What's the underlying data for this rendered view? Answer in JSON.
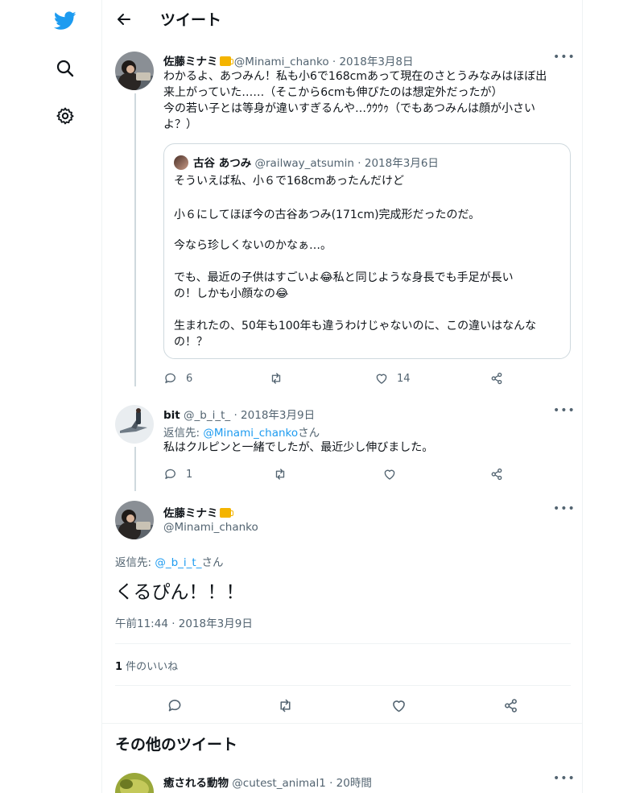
{
  "app": {
    "brand_color": "#1d9bf0",
    "text_color": "#0f1419",
    "muted_color": "#536471"
  },
  "sidebar": {
    "items": [
      {
        "icon": "twitter-logo-icon"
      },
      {
        "icon": "search-icon"
      },
      {
        "icon": "settings-gear-icon"
      }
    ]
  },
  "header": {
    "title": "ツイート"
  },
  "tweet1": {
    "name": "佐藤ミナミ",
    "handle": "@Minami_chanko",
    "date": "2018年3月8日",
    "lines": [
      "わかるよ、あつみん！私も小6で168cmあって現在のさとうみなみはほぼ出",
      "来上がっていた……（そこから6cmも伸びたのは想定外だったが）",
      "今の若い子とは等身が違いすぎるんや…ｳｳｳｩ（でもあつみんは顔が小さい",
      "よ？）"
    ],
    "quote": {
      "name": "古谷 あつみ",
      "handle": "@railway_atsumin",
      "date": "2018年3月6日",
      "paragraphs": [
        [
          "そういえば私、小６で168cmあったんだけど"
        ],
        [
          "小６にしてほぼ今の古谷あつみ(171cm)完成形だったのだ。"
        ],
        [
          "今なら珍しくないのかなぁ…。"
        ],
        [
          "でも、最近の子供はすごいよ😂私と同じような身長でも手足が長い",
          "の！しかも小顔なの😂"
        ],
        [
          "生まれたの、50年も100年も違うわけじゃないのに、この違いはなんな",
          "の！？"
        ]
      ]
    },
    "actions": {
      "reply_count": "6",
      "retweet_count": "",
      "like_count": "14"
    }
  },
  "tweet2": {
    "name": "bit",
    "handle": "@_b_i_t_",
    "date": "2018年3月9日",
    "reply_prefix": "返信先: ",
    "reply_to": "@Minami_chanko",
    "reply_suffix": "さん",
    "text": "私はクルピンと一緒でしたが、最近少し伸びました。",
    "actions": {
      "reply_count": "1",
      "retweet_count": "",
      "like_count": ""
    }
  },
  "main_tweet": {
    "name": "佐藤ミナミ",
    "handle": "@Minami_chanko",
    "reply_prefix": "返信先: ",
    "reply_to": "@_b_i_t_",
    "reply_suffix": "さん",
    "text": "くるぴん！！！",
    "timestamp": "午前11:44 · 2018年3月9日",
    "likes_count": "1",
    "likes_label": " 件のいいね"
  },
  "more_tweets": {
    "title": "その他のツイート",
    "first": {
      "name": "癒される動物",
      "handle": "@cutest_animal1",
      "date": "20時間"
    }
  },
  "dot": " · "
}
